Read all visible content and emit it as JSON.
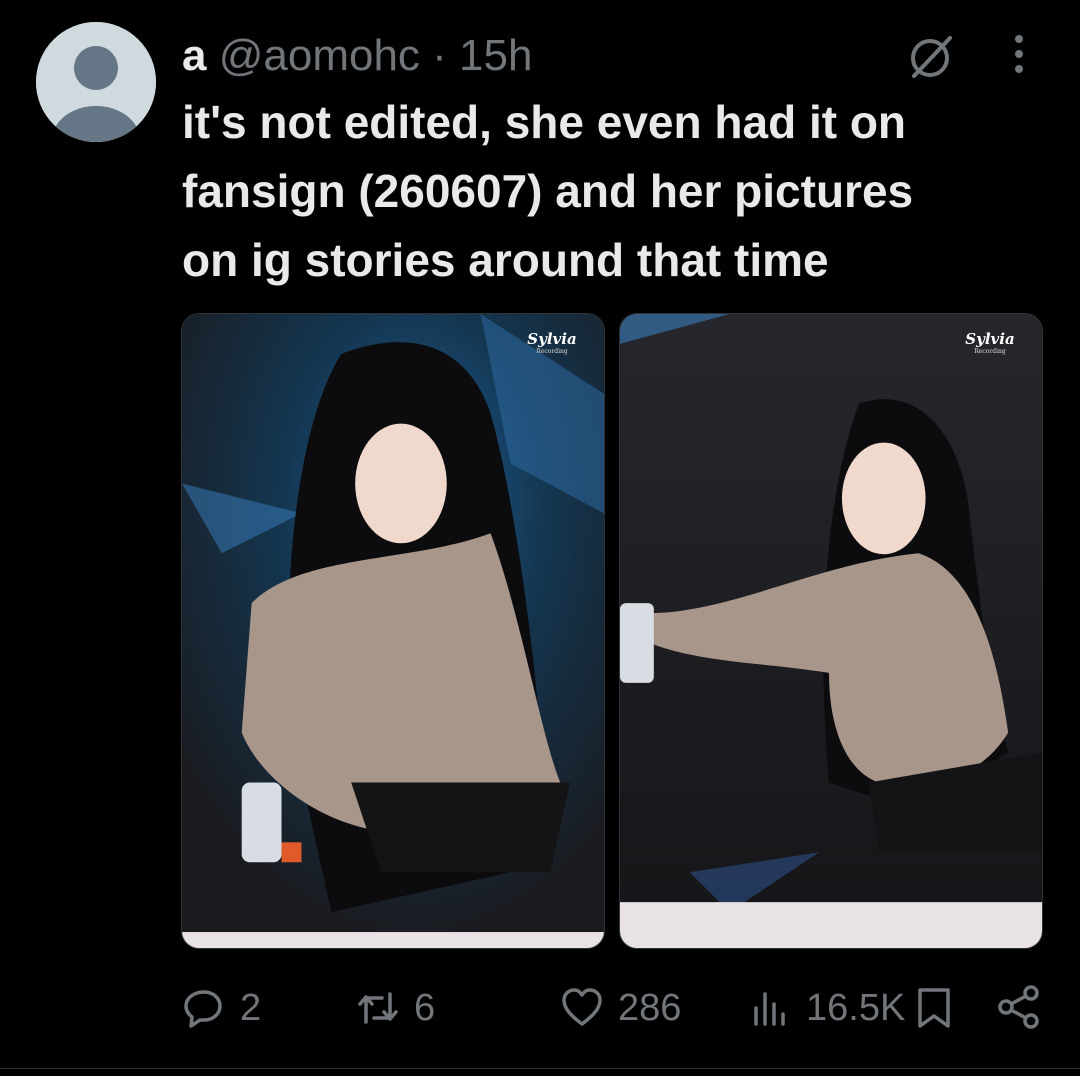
{
  "tweet": {
    "author": {
      "display_name": "a",
      "handle": "@aomohc",
      "separator": "·",
      "time": "15h",
      "avatar_icon": "default-avatar-icon"
    },
    "text": "it's not edited, she even had it on\nfansign (260607) and her pictures\non ig stories around that time",
    "media": [
      {
        "watermark": "Sylvia",
        "watermark_sub": "Recording"
      },
      {
        "watermark": "Sylvia",
        "watermark_sub": "Recording"
      }
    ],
    "actions": {
      "reply": {
        "icon": "reply-icon",
        "count": "2"
      },
      "retweet": {
        "icon": "retweet-icon",
        "count": "6"
      },
      "like": {
        "icon": "heart-icon",
        "count": "286"
      },
      "views": {
        "icon": "views-icon",
        "count": "16.5K"
      },
      "bookmark": {
        "icon": "bookmark-icon"
      },
      "share": {
        "icon": "share-icon"
      }
    },
    "header_icons": [
      "grok-icon",
      "more-icon"
    ]
  },
  "colors": {
    "background": "#000000",
    "text_primary": "#e7e9ea",
    "text_secondary": "#71767b",
    "border": "#2f3336",
    "avatar_bg": "#cfd9de"
  }
}
